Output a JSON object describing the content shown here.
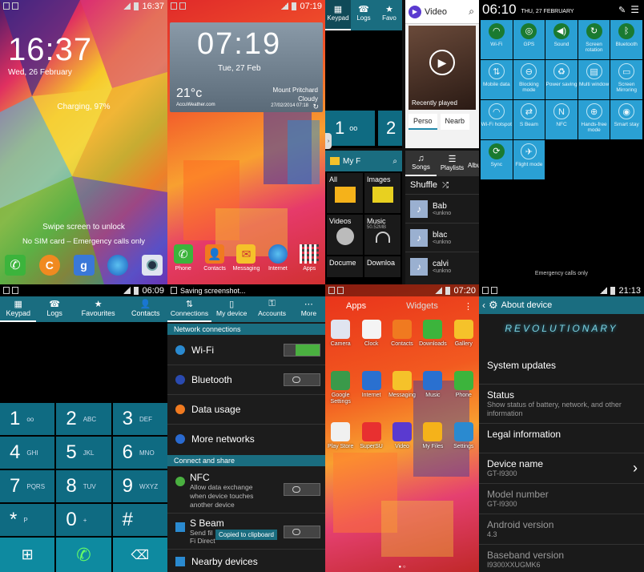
{
  "lock": {
    "time": "16:37",
    "date": "Wed, 26 February",
    "charging": "Charging, 97%",
    "swipe": "Swipe screen to unlock",
    "emergency": "No SIM card – Emergency calls only",
    "status_time": "16:37"
  },
  "home": {
    "status_time": "07:19",
    "clock": "07:19",
    "date": "Tue, 27 Feb",
    "temp": "21°c",
    "location": "Mount Pritchard",
    "weather": "Cloudy",
    "updated": "27/02/2014 07:18",
    "brand": "AccuWeather.com",
    "dock": [
      "Phone",
      "Contacts",
      "Messaging",
      "Internet",
      "Apps"
    ]
  },
  "multi": {
    "tabs": [
      "Keypad",
      "Logs",
      "Favo"
    ],
    "video_title": "Video",
    "recently": "Recently played",
    "video_tabs": [
      "Perso",
      "Nearb"
    ],
    "myfiles": "My F",
    "files": [
      "All",
      "Images",
      "Videos",
      "Music",
      "Docume",
      "Downloa"
    ],
    "music_size": "50.52MB",
    "music_tabs": [
      "Songs",
      "Playlists",
      "Albu"
    ],
    "shuffle": "Shuffle",
    "songs": [
      {
        "t": "Bab",
        "a": "<unkno"
      },
      {
        "t": "blac",
        "a": "<unkno"
      },
      {
        "t": "calvi",
        "a": "<unkno"
      }
    ],
    "digit1": "1",
    "digit2": "2"
  },
  "qs": {
    "time": "06:10",
    "date": "THU, 27 FEBRUARY",
    "emergency": "Emergency calls only",
    "tiles": [
      "Wi-Fi",
      "GPS",
      "Sound",
      "Screen rotation",
      "Bluetooth",
      "Mobile data",
      "Blocking mode",
      "Power saving",
      "Multi window",
      "Screen Mirroring",
      "Wi-Fi hotspot",
      "S Beam",
      "NFC",
      "Hands-free mode",
      "Smart stay",
      "Sync",
      "Flight mode"
    ]
  },
  "dialer": {
    "status_time": "06:09",
    "tabs": [
      "Keypad",
      "Logs",
      "Favourites",
      "Contacts"
    ],
    "keys": [
      {
        "d": "1",
        "s": "oo"
      },
      {
        "d": "2",
        "s": "ABC"
      },
      {
        "d": "3",
        "s": "DEF"
      },
      {
        "d": "4",
        "s": "GHI"
      },
      {
        "d": "5",
        "s": "JKL"
      },
      {
        "d": "6",
        "s": "MNO"
      },
      {
        "d": "7",
        "s": "PQRS"
      },
      {
        "d": "8",
        "s": "TUV"
      },
      {
        "d": "9",
        "s": "WXYZ"
      },
      {
        "d": "*",
        "s": "P"
      },
      {
        "d": "0",
        "s": "+"
      },
      {
        "d": "#",
        "s": ""
      }
    ]
  },
  "settings": {
    "status": "Saving screenshot...",
    "tabs": [
      "Connections",
      "My device",
      "Accounts",
      "More"
    ],
    "sec1": "Network connections",
    "items": [
      "Wi-Fi",
      "Bluetooth",
      "Data usage",
      "More networks"
    ],
    "sec2": "Connect and share",
    "nfc": "NFC",
    "nfc_desc": "Allow data exchange when device touches another device",
    "sbeam": "S Beam",
    "sbeam_desc": "Send fil",
    "sbeam_desc2": "Fi Direct",
    "toast": "Copied to clipboard",
    "nearby": "Nearby devices"
  },
  "drawer": {
    "status_time": "07:20",
    "tabs": [
      "Apps",
      "Widgets"
    ],
    "apps": [
      "Camera",
      "Clock",
      "Contacts",
      "Downloads",
      "Gallery",
      "Google Settings",
      "Internet",
      "Messaging",
      "Music",
      "Phone",
      "Play Store",
      "SuperSU",
      "Video",
      "My Files",
      "Settings"
    ]
  },
  "about": {
    "status_time": "21:13",
    "title": "About device",
    "banner": "REVOLUTIONARY",
    "items": [
      {
        "t": "System updates",
        "d": ""
      },
      {
        "t": "Status",
        "d": "Show status of battery, network, and other information"
      },
      {
        "t": "Legal information",
        "d": ""
      },
      {
        "t": "Device name",
        "d": "GT-I9300"
      },
      {
        "t": "Model number",
        "d": "GT-I9300"
      },
      {
        "t": "Android version",
        "d": "4.3"
      },
      {
        "t": "Baseband version",
        "d": "I9300XXUGMK6"
      }
    ]
  },
  "colors": {
    "teal": "#1a6d80",
    "qs_tile": "#2aa0d4",
    "dialer_key": "#0f6b82",
    "dialer_bottom": "#0e8aa0",
    "settings_bg": "#1c1c1c",
    "about_bg": "#1a1a1a"
  }
}
